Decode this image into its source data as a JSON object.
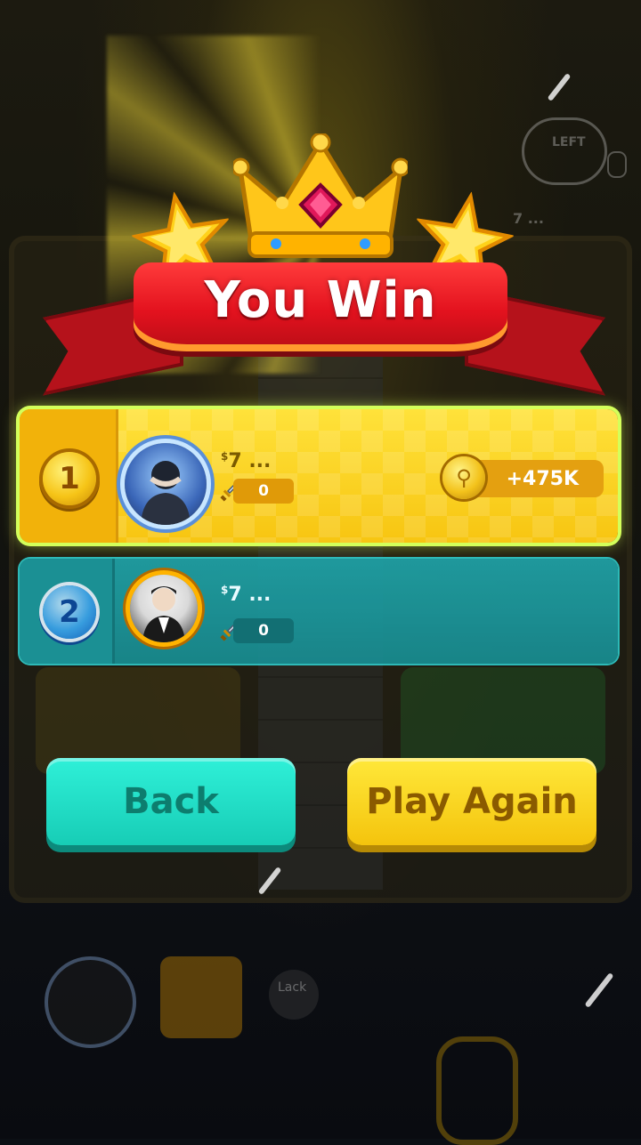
{
  "banner": {
    "title": "You Win"
  },
  "results": [
    {
      "rank": "1",
      "name": "7 ...",
      "name_prefix": "$",
      "swords": "0",
      "reward": "+475K"
    },
    {
      "rank": "2",
      "name": "7 ...",
      "name_prefix": "$",
      "swords": "0"
    }
  ],
  "buttons": {
    "back": "Back",
    "play_again": "Play Again"
  },
  "background": {
    "left_label": "LEFT",
    "lack_label": "Lack",
    "opponent_tag": "7 ..."
  },
  "colors": {
    "winner_row": "#f7c511",
    "loser_row": "#188d92",
    "back_button": "#17cdb6",
    "play_button": "#f4c40d",
    "ribbon": "#e3121e"
  }
}
